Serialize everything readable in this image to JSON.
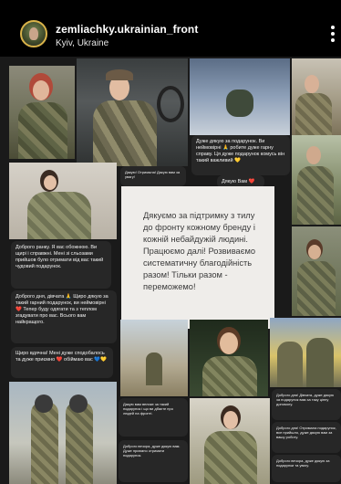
{
  "header": {
    "username": "zemliachky.ukrainian_front",
    "location": "Kyiv, Ukraine"
  },
  "post": {
    "main_message": "Дякуємо за підтримку з тилу до фронту кожному бренду і кожній небайдужій людині. Працюємо далі! Розвиваємо систематичну благодійність разом! Тільки разом - переможемо!",
    "messages": [
      {
        "text": "Доброго ранку. Я вас обожнюю. Ви щирі і справжні. Мені зі сльозами прийшов було отримати від вас такий чудовий подарунок."
      },
      {
        "text": "Доброго дня, дівчата 🙏 Щиро дякую за такий гарний подарунок, ви неймовірні ❤️ Тепер буду одягати та з теплом згадувати про вас. Всього вам найкращого."
      },
      {
        "text": "Щиро вдячна! Мені дуже сподобалось та дуже приємно ❤️ обіймаю вас 💙💛"
      },
      {
        "text": "Дуже дякую за подарунок. Ви неймовірні 🙏 робите дуже гарну справу. Ця дуже подарунок комусь він такий важливий 💛"
      },
      {
        "text": "Дякую Вам ❤️"
      },
      {
        "text": "Дякую! Отримала! Дякую вам за увагу!"
      },
      {
        "text": "Дякую вам велике за такий подарунок і що ви дбаєте про людей на фронті."
      },
      {
        "text": "Доброго вечора, дуже дякую вам. Дуже приємно отримати подарунок."
      },
      {
        "text": "Доброго дня! Дівчата, дуже дякую за подарунок вам за таку цінну допомогу."
      },
      {
        "text": "Доброго дня! Отримала подарунок, все прийшло, дуже дякую вам за вашу роботу."
      },
      {
        "text": "Доброго вечора, дуже дякую за подарунки та увагу."
      }
    ]
  }
}
